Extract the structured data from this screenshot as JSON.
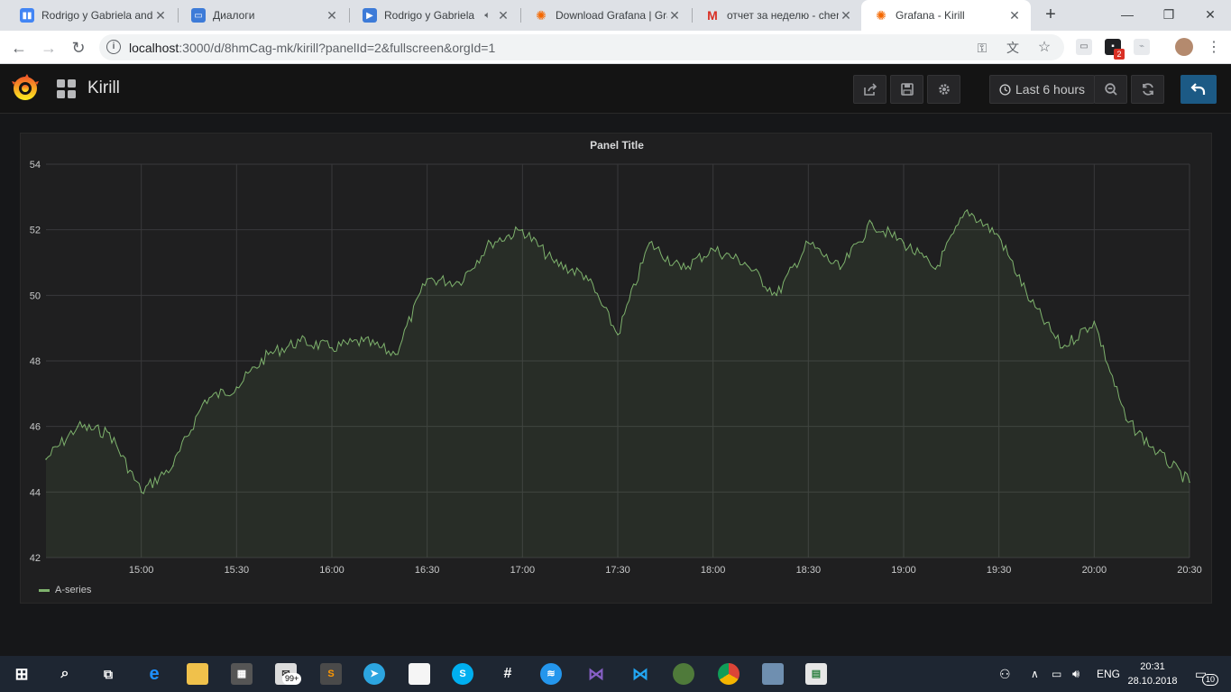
{
  "browser": {
    "tabs": [
      {
        "title": "Rodrigo y Gabriela and",
        "icon": "video-icon",
        "color": "#4285f4"
      },
      {
        "title": "Диалоги",
        "icon": "chat-icon",
        "color": "#3d7bd8"
      },
      {
        "title": "Rodrigo y Gabriela",
        "icon": "play-icon",
        "color": "#3d7bd8",
        "audio": true
      },
      {
        "title": "Download Grafana | Gra",
        "icon": "grafana-icon",
        "color": "#f46800"
      },
      {
        "title": "отчет за неделю - chen",
        "icon": "gmail-icon",
        "color": "#d93025"
      },
      {
        "title": "Grafana - Kirill",
        "icon": "grafana-icon",
        "color": "#f46800",
        "active": true
      }
    ],
    "new_tab": "+",
    "window_controls": {
      "minimize": "—",
      "maximize": "❐",
      "close": "✕"
    },
    "url_host": "localhost",
    "url_rest": ":3000/d/8hmCag-mk/kirill?panelId=2&fullscreen&orgId=1",
    "extension_badge": "2"
  },
  "grafana": {
    "dashboard_title": "Kirill",
    "time_range_label": "Last 6 hours",
    "panel_title": "Panel Title",
    "series_color": "#7eb26d"
  },
  "chart_data": {
    "type": "area",
    "title": "Panel Title",
    "ylim": [
      42,
      54
    ],
    "yticks": [
      42,
      44,
      46,
      48,
      50,
      52,
      54
    ],
    "x_range": [
      "14:30",
      "20:30"
    ],
    "xticks": [
      "15:00",
      "15:30",
      "16:00",
      "16:30",
      "17:00",
      "17:30",
      "18:00",
      "18:30",
      "19:00",
      "19:30",
      "20:00",
      "20:30"
    ],
    "grid": true,
    "legend_position": "bottom-left",
    "series": [
      {
        "name": "A-series",
        "x": [
          "14:30",
          "14:40",
          "14:50",
          "15:00",
          "15:10",
          "15:20",
          "15:30",
          "15:40",
          "15:50",
          "16:00",
          "16:10",
          "16:20",
          "16:30",
          "16:40",
          "16:50",
          "17:00",
          "17:10",
          "17:20",
          "17:30",
          "17:40",
          "17:50",
          "18:00",
          "18:10",
          "18:20",
          "18:30",
          "18:40",
          "18:50",
          "19:00",
          "19:10",
          "19:20",
          "19:30",
          "19:40",
          "19:50",
          "20:00",
          "20:10",
          "20:20",
          "20:30"
        ],
        "values": [
          45.0,
          46.0,
          45.8,
          44.0,
          44.8,
          46.8,
          47.2,
          48.2,
          48.6,
          48.4,
          48.6,
          48.2,
          50.5,
          50.4,
          51.6,
          52.0,
          51.0,
          50.6,
          48.8,
          51.6,
          50.8,
          51.4,
          51.0,
          50.0,
          51.6,
          50.8,
          52.2,
          51.6,
          50.8,
          52.6,
          51.8,
          49.8,
          48.4,
          49.2,
          46.2,
          45.2,
          44.3
        ]
      }
    ]
  },
  "taskbar": {
    "icons": [
      "windows-icon",
      "search-icon",
      "task-view-icon",
      "edge-icon",
      "file-explorer-icon",
      "store-icon",
      "mail-icon",
      "sublime-icon",
      "telegram-icon",
      "notepad-icon",
      "skype-icon",
      "slack-icon",
      "docker-icon",
      "visual-studio-icon",
      "vscode-icon",
      "tree-app-icon",
      "chrome-icon",
      "monitor-icon",
      "dashboard-app-icon"
    ],
    "mail_badge": "99+",
    "language": "ENG",
    "time": "20:31",
    "date": "28.10.2018",
    "notifications_count": "10"
  }
}
